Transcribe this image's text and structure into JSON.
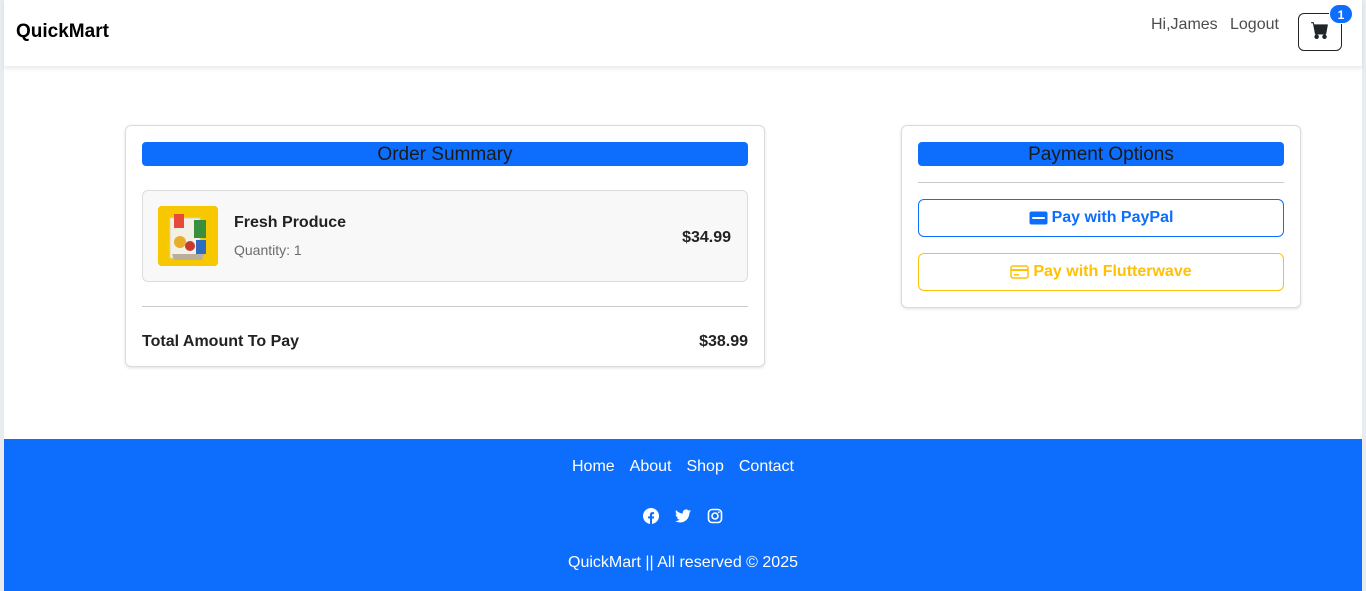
{
  "navbar": {
    "brand": "QuickMart",
    "greeting": "Hi,James",
    "logout": "Logout",
    "cart_count": "1",
    "cart_icon": "shopping-cart-icon"
  },
  "order_summary": {
    "title": "Order Summary",
    "items": [
      {
        "name": "Fresh Produce",
        "quantity": "Quantity: 1",
        "price": "$34.99",
        "image": "grocery-bag-image"
      }
    ],
    "total_label": "Total Amount To Pay",
    "total_value": "$38.99"
  },
  "payment": {
    "title": "Payment Options",
    "paypal_label": "Pay with PayPal",
    "paypal_icon": "paypal-icon",
    "flutterwave_label": "Pay with Flutterwave",
    "flutterwave_icon": "credit-card-icon"
  },
  "footer": {
    "links": [
      "Home",
      "About",
      "Shop",
      "Contact"
    ],
    "social": [
      "facebook-icon",
      "twitter-icon",
      "instagram-icon"
    ],
    "copyright": "QuickMart || All reserved © 2025"
  },
  "colors": {
    "primary": "#0d6efd",
    "warning": "#ffc107"
  }
}
